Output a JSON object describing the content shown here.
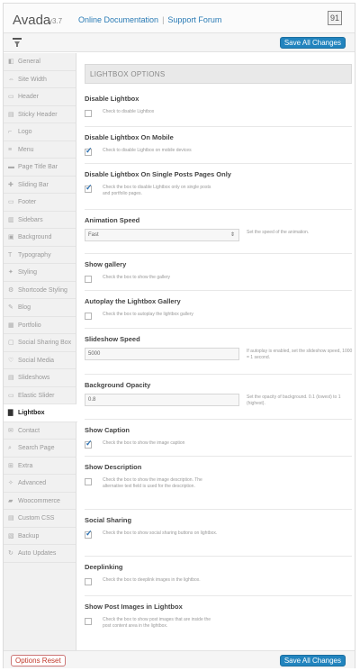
{
  "header": {
    "brand": "Avada",
    "version": "v3.7",
    "doc_link": "Online Documentation",
    "support_link": "Support Forum",
    "logo_glyph": "91"
  },
  "toolbar": {
    "save_label": "Save All Changes"
  },
  "sidebar": {
    "items": [
      {
        "label": "General",
        "icon": "◧"
      },
      {
        "label": "Site Width",
        "icon": "⇔"
      },
      {
        "label": "Header",
        "icon": "▭"
      },
      {
        "label": "Sticky Header",
        "icon": "▤"
      },
      {
        "label": "Logo",
        "icon": "⌐"
      },
      {
        "label": "Menu",
        "icon": "≡"
      },
      {
        "label": "Page Title Bar",
        "icon": "▬"
      },
      {
        "label": "Sliding Bar",
        "icon": "✚"
      },
      {
        "label": "Footer",
        "icon": "▭"
      },
      {
        "label": "Sidebars",
        "icon": "▥"
      },
      {
        "label": "Background",
        "icon": "▣"
      },
      {
        "label": "Typography",
        "icon": "T"
      },
      {
        "label": "Styling",
        "icon": "✦"
      },
      {
        "label": "Shortcode Styling",
        "icon": "⚙"
      },
      {
        "label": "Blog",
        "icon": "✎"
      },
      {
        "label": "Portfolio",
        "icon": "▦"
      },
      {
        "label": "Social Sharing Box",
        "icon": "▢"
      },
      {
        "label": "Social Media",
        "icon": "♡"
      },
      {
        "label": "Slideshows",
        "icon": "▤"
      },
      {
        "label": "Elastic Slider",
        "icon": "▭"
      },
      {
        "label": "Lightbox",
        "icon": "▇"
      },
      {
        "label": "Contact",
        "icon": "✉"
      },
      {
        "label": "Search Page",
        "icon": "⌕"
      },
      {
        "label": "Extra",
        "icon": "⊞"
      },
      {
        "label": "Advanced",
        "icon": "✧"
      },
      {
        "label": "Woocommerce",
        "icon": "▰"
      },
      {
        "label": "Custom CSS",
        "icon": "▤"
      },
      {
        "label": "Backup",
        "icon": "▧"
      },
      {
        "label": "Auto Updates",
        "icon": "↻"
      }
    ],
    "active_index": 20
  },
  "main": {
    "section_title": "LIGHTBOX OPTIONS",
    "options": [
      {
        "title": "Disable Lightbox",
        "desc": "Check to disable Lightbox",
        "checked": false
      },
      {
        "title": "Disable Lightbox On Mobile",
        "desc": "Check to disable Lightbox on mobile devices",
        "checked": true
      },
      {
        "title": "Disable Lightbox On Single Posts Pages Only",
        "desc": "Check the box to disable Lightbox only on single posts and portfolio pages.",
        "checked": true
      },
      {
        "title": "Animation Speed",
        "value": "Fast",
        "side_desc": "Set the speed of the animation."
      },
      {
        "title": "Show gallery",
        "desc": "Check the box to show the gallery",
        "checked": false
      },
      {
        "title": "Autoplay the Lightbox Gallery",
        "desc": "Check the box to autoplay the lightbox gallery",
        "checked": false
      },
      {
        "title": "Slideshow Speed",
        "value": "5000",
        "side_desc": "If autoplay is enabled, set the slideshow speed, 1000 = 1 second."
      },
      {
        "title": "Background Opacity",
        "value": "0.8",
        "side_desc": "Set the opacity of background. 0.1 (lowest) to 1 (highest)."
      },
      {
        "title": "Show Caption",
        "desc": "Check the box to show the image caption",
        "checked": true
      },
      {
        "title": "Show Description",
        "desc": "Check the box to show the image description. The alternative text field is used for the description.",
        "checked": false
      },
      {
        "title": "Social Sharing",
        "desc": "Check the box to show social sharing buttons on lightbox.",
        "checked": true
      },
      {
        "title": "Deeplinking",
        "desc": "Check the box to deeplink images in the lightbox.",
        "checked": false
      },
      {
        "title": "Show Post Images in Lightbox",
        "desc": "Check the box to show post images that are inside the post content area in the lightbox.",
        "checked": false
      }
    ]
  },
  "footer": {
    "reset_label": "Options Reset",
    "save_label": "Save All Changes"
  },
  "colors": {
    "accent": "#2284be",
    "reset": "#c0392b"
  }
}
